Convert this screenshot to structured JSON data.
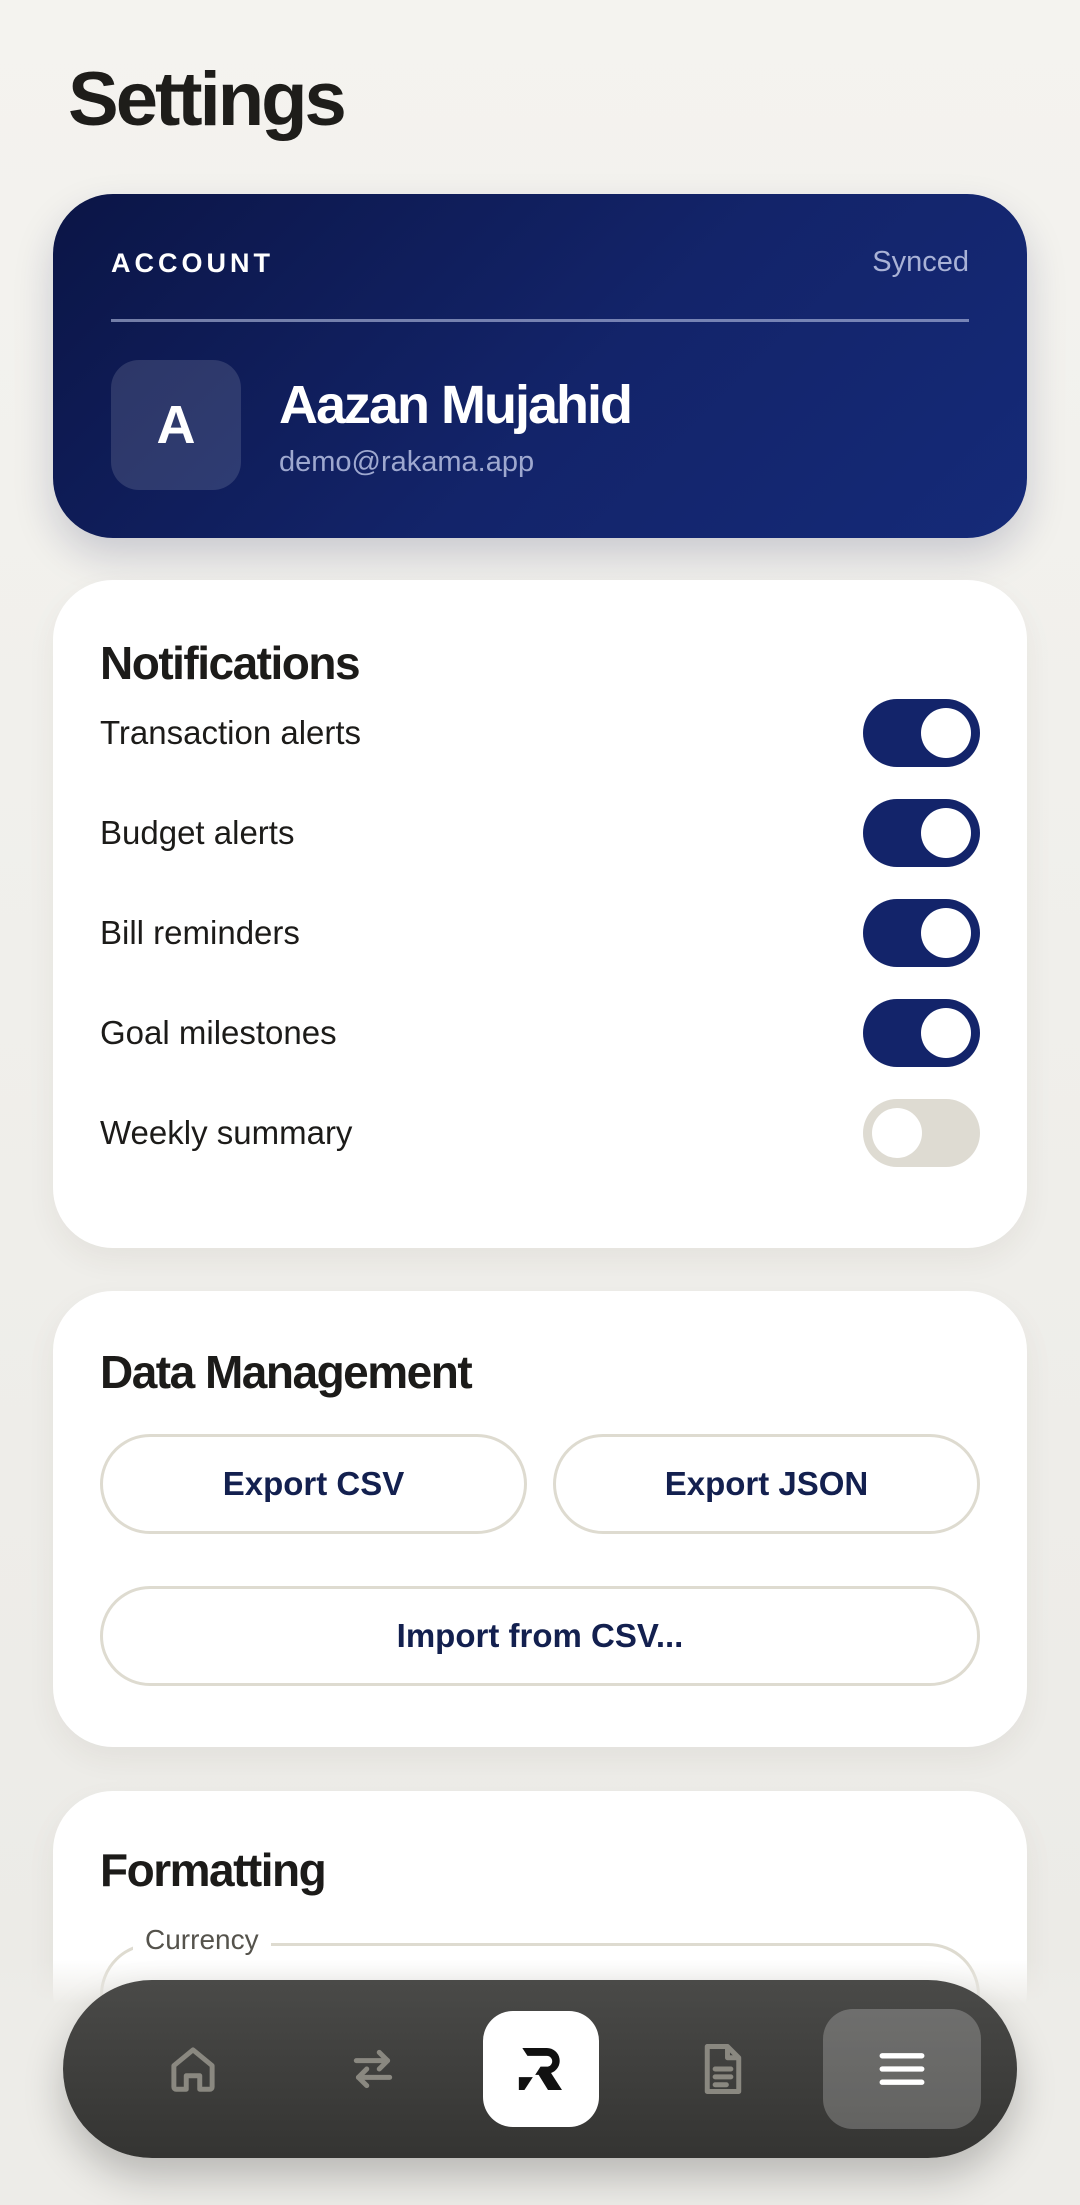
{
  "page": {
    "title": "Settings"
  },
  "account": {
    "label": "ACCOUNT",
    "status": "Synced",
    "avatar_initial": "A",
    "name": "Aazan Mujahid",
    "email": "demo@rakama.app"
  },
  "notifications": {
    "title": "Notifications",
    "items": [
      {
        "label": "Transaction alerts",
        "enabled": true
      },
      {
        "label": "Budget alerts",
        "enabled": true
      },
      {
        "label": "Bill reminders",
        "enabled": true
      },
      {
        "label": "Goal milestones",
        "enabled": true
      },
      {
        "label": "Weekly summary",
        "enabled": false
      }
    ]
  },
  "data_management": {
    "title": "Data Management",
    "export_csv": "Export CSV",
    "export_json": "Export JSON",
    "import_csv": "Import from CSV..."
  },
  "formatting": {
    "title": "Formatting",
    "currency_label": "Currency"
  },
  "bottom_nav": {
    "items": [
      {
        "icon": "home-icon"
      },
      {
        "icon": "transfer-icon"
      },
      {
        "icon": "app-logo-icon"
      },
      {
        "icon": "document-icon"
      },
      {
        "icon": "menu-icon",
        "active": true
      }
    ]
  },
  "colors": {
    "accent": "#13246a",
    "toggle_off": "#dedbd2",
    "background": "#f2f1ed"
  }
}
